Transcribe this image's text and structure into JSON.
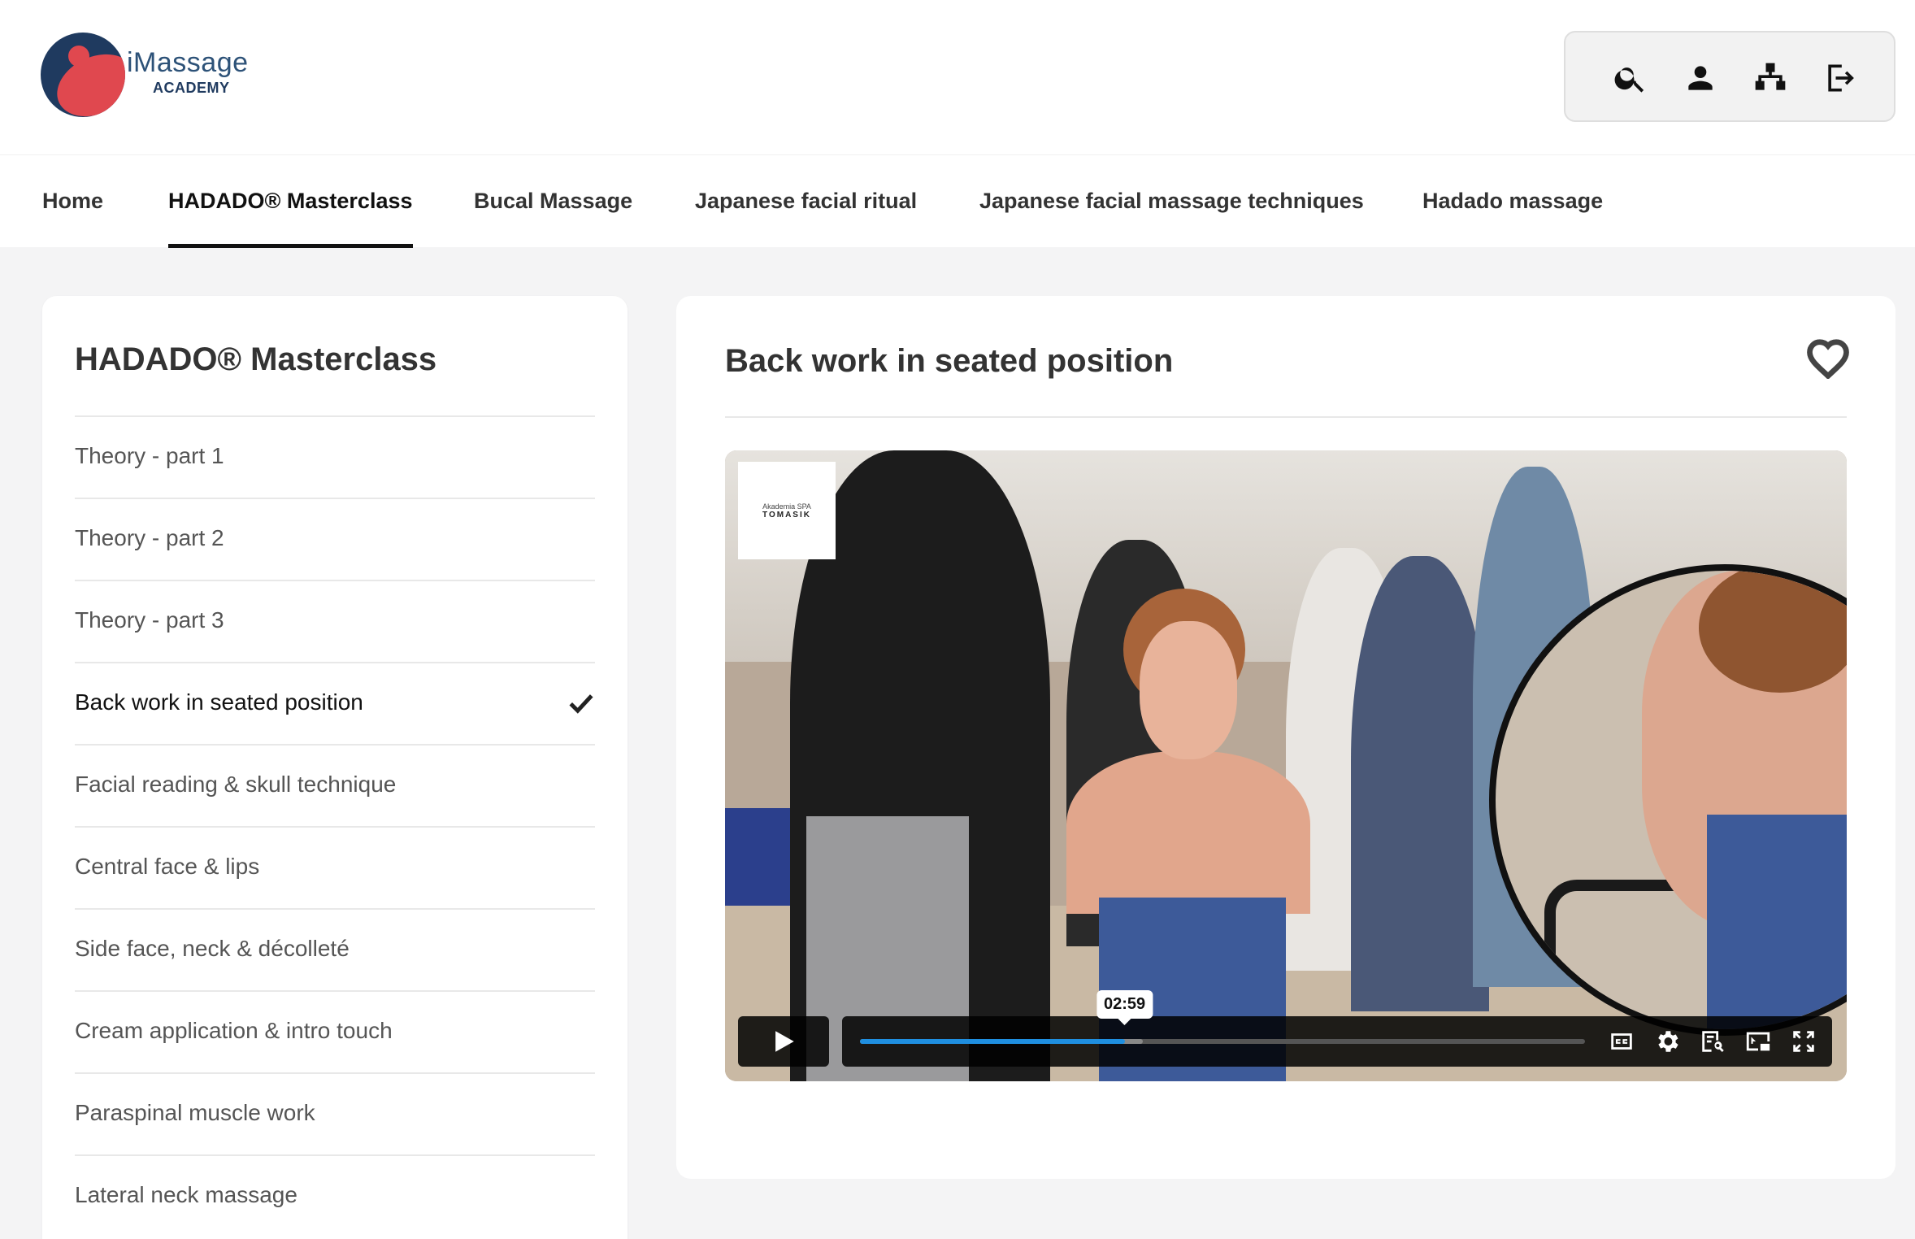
{
  "brand": {
    "name_line1": "iMassage",
    "name_line2": "ACADEMY"
  },
  "header_icons": [
    "search-icon",
    "user-icon",
    "sitemap-icon",
    "logout-icon"
  ],
  "nav": {
    "items": [
      {
        "label": "Home"
      },
      {
        "label": "HADADO® Masterclass",
        "active": true
      },
      {
        "label": "Bucal Massage"
      },
      {
        "label": "Japanese facial ritual"
      },
      {
        "label": "Japanese facial massage techniques"
      },
      {
        "label": "Hadado massage"
      }
    ]
  },
  "sidebar": {
    "title": "HADADO® Masterclass",
    "lessons": [
      {
        "label": "Theory - part 1"
      },
      {
        "label": "Theory - part 2"
      },
      {
        "label": "Theory - part 3"
      },
      {
        "label": "Back work in seated position",
        "current": true,
        "completed": true
      },
      {
        "label": "Facial reading & skull technique"
      },
      {
        "label": "Central face & lips"
      },
      {
        "label": "Side face, neck & décolleté"
      },
      {
        "label": "Cream application & intro touch"
      },
      {
        "label": "Paraspinal muscle work"
      },
      {
        "label": "Lateral neck massage"
      }
    ]
  },
  "main": {
    "title": "Back work in seated position",
    "favorite_icon": "heart-icon"
  },
  "video": {
    "watermark_line1": "Akademia SPA",
    "watermark_line2": "TOMASIK",
    "time_tooltip": "02:59",
    "progress_fraction": 0.365,
    "buffered_fraction": 0.39,
    "progress_color": "#1f8fe0",
    "controls": [
      "play-icon",
      "closed-captions-icon",
      "settings-icon",
      "transcript-icon",
      "picture-in-picture-icon",
      "fullscreen-icon"
    ]
  }
}
